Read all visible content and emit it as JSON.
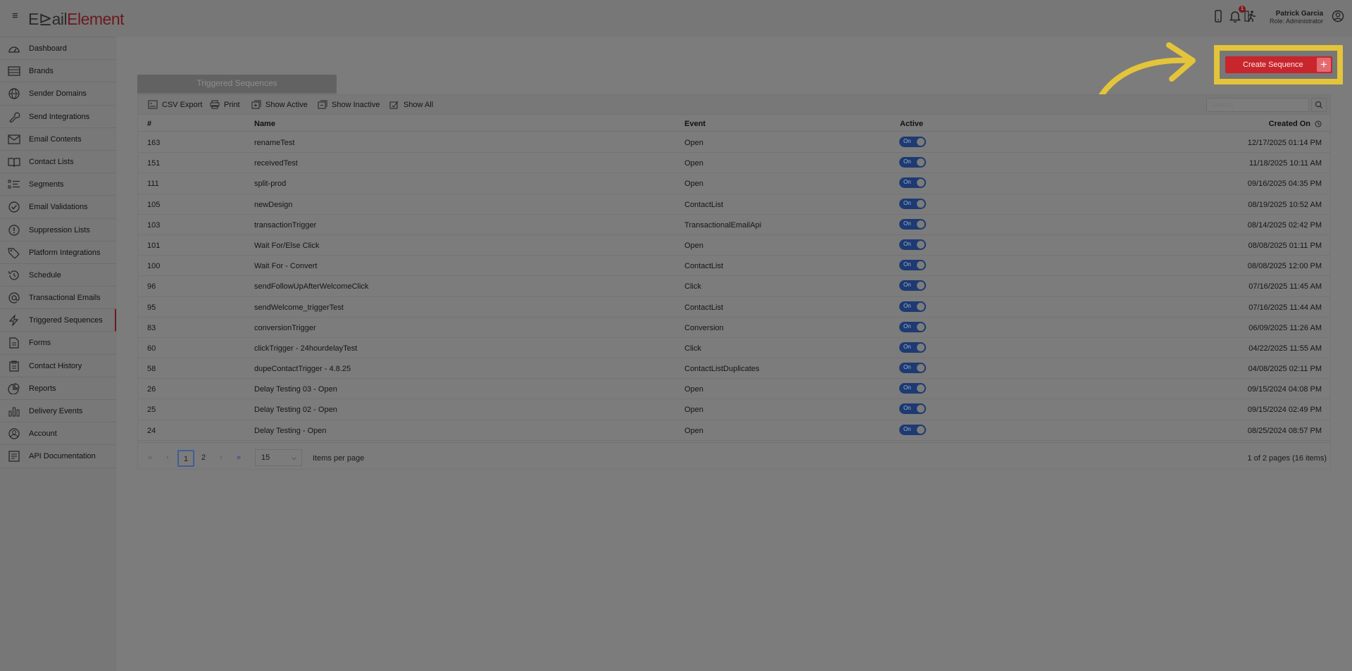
{
  "app": {
    "logo_part1": "E",
    "logo_part2": "ail",
    "logo_part3": "Element",
    "user_name": "Patrick Garcia",
    "user_role": "Role: Administrator",
    "notification_count": "1"
  },
  "sidebar": {
    "items": [
      {
        "label": "Dashboard",
        "icon": "dashboard-icon"
      },
      {
        "label": "Brands",
        "icon": "brands-icon"
      },
      {
        "label": "Sender Domains",
        "icon": "globe-icon"
      },
      {
        "label": "Send Integrations",
        "icon": "wrench-icon"
      },
      {
        "label": "Email Contents",
        "icon": "envelope-icon"
      },
      {
        "label": "Contact Lists",
        "icon": "book-icon"
      },
      {
        "label": "Segments",
        "icon": "segments-icon"
      },
      {
        "label": "Email Validations",
        "icon": "check-circle-icon"
      },
      {
        "label": "Suppression Lists",
        "icon": "exclamation-circle-icon"
      },
      {
        "label": "Platform Integrations",
        "icon": "tag-icon"
      },
      {
        "label": "Schedule",
        "icon": "history-icon"
      },
      {
        "label": "Transactional Emails",
        "icon": "at-icon"
      },
      {
        "label": "Triggered Sequences",
        "icon": "lightning-icon",
        "active": true
      },
      {
        "label": "Forms",
        "icon": "document-icon"
      },
      {
        "label": "Contact History",
        "icon": "clipboard-icon"
      },
      {
        "label": "Reports",
        "icon": "pie-chart-icon"
      },
      {
        "label": "Delivery Events",
        "icon": "bar-chart-icon"
      },
      {
        "label": "Account",
        "icon": "user-circle-icon"
      },
      {
        "label": "API Documentation",
        "icon": "api-doc-icon"
      }
    ]
  },
  "main": {
    "create_button": "Create Sequence",
    "create_plus": "+",
    "tab_title": "Triggered Sequences",
    "toolbar": {
      "csv_export": "CSV Export",
      "print": "Print",
      "show_active": "Show Active",
      "show_inactive": "Show Inactive",
      "show_all": "Show All",
      "search_placeholder": "Search"
    },
    "columns": {
      "id": "#",
      "name": "Name",
      "event": "Event",
      "active": "Active",
      "created_on": "Created On"
    },
    "rows": [
      {
        "id": "163",
        "name": "renameTest",
        "event": "Open",
        "active": "On",
        "created": "12/17/2025 01:14 PM"
      },
      {
        "id": "151",
        "name": "receivedTest",
        "event": "Open",
        "active": "On",
        "created": "11/18/2025 10:11 AM"
      },
      {
        "id": "111",
        "name": "split-prod",
        "event": "Open",
        "active": "On",
        "created": "09/16/2025 04:35 PM"
      },
      {
        "id": "105",
        "name": "newDesign",
        "event": "ContactList",
        "active": "On",
        "created": "08/19/2025 10:52 AM"
      },
      {
        "id": "103",
        "name": "transactionTrigger",
        "event": "TransactionalEmailApi",
        "active": "On",
        "created": "08/14/2025 02:42 PM"
      },
      {
        "id": "101",
        "name": "Wait For/Else Click",
        "event": "Open",
        "active": "On",
        "created": "08/08/2025 01:11 PM"
      },
      {
        "id": "100",
        "name": "Wait For - Convert",
        "event": "ContactList",
        "active": "On",
        "created": "08/08/2025 12:00 PM"
      },
      {
        "id": "96",
        "name": "sendFollowUpAfterWelcomeClick",
        "event": "Click",
        "active": "On",
        "created": "07/16/2025 11:45 AM"
      },
      {
        "id": "95",
        "name": "sendWelcome_triggerTest",
        "event": "ContactList",
        "active": "On",
        "created": "07/16/2025 11:44 AM"
      },
      {
        "id": "83",
        "name": "conversionTrigger",
        "event": "Conversion",
        "active": "On",
        "created": "06/09/2025 11:26 AM"
      },
      {
        "id": "60",
        "name": "clickTrigger - 24hourdelayTest",
        "event": "Click",
        "active": "On",
        "created": "04/22/2025 11:55 AM"
      },
      {
        "id": "58",
        "name": "dupeContactTrigger - 4.8.25",
        "event": "ContactListDuplicates",
        "active": "On",
        "created": "04/08/2025 02:11 PM"
      },
      {
        "id": "26",
        "name": "Delay Testing 03 - Open",
        "event": "Open",
        "active": "On",
        "created": "09/15/2024 04:08 PM"
      },
      {
        "id": "25",
        "name": "Delay Testing 02 - Open",
        "event": "Open",
        "active": "On",
        "created": "09/15/2024 02:49 PM"
      },
      {
        "id": "24",
        "name": "Delay Testing - Open",
        "event": "Open",
        "active": "On",
        "created": "08/25/2024 08:57 PM"
      }
    ],
    "pager": {
      "first": "«",
      "prev": "‹",
      "page1": "1",
      "page2": "2",
      "next": "›",
      "last": "»",
      "per_page": "15",
      "per_page_label": "Items per page",
      "info": "1 of 2 pages (16 items)"
    }
  },
  "colors": {
    "highlight": "#e4c43b",
    "primary_button": "#c8252d",
    "toggle_on": "#1d3a72",
    "brand": "#6b1a1f"
  }
}
